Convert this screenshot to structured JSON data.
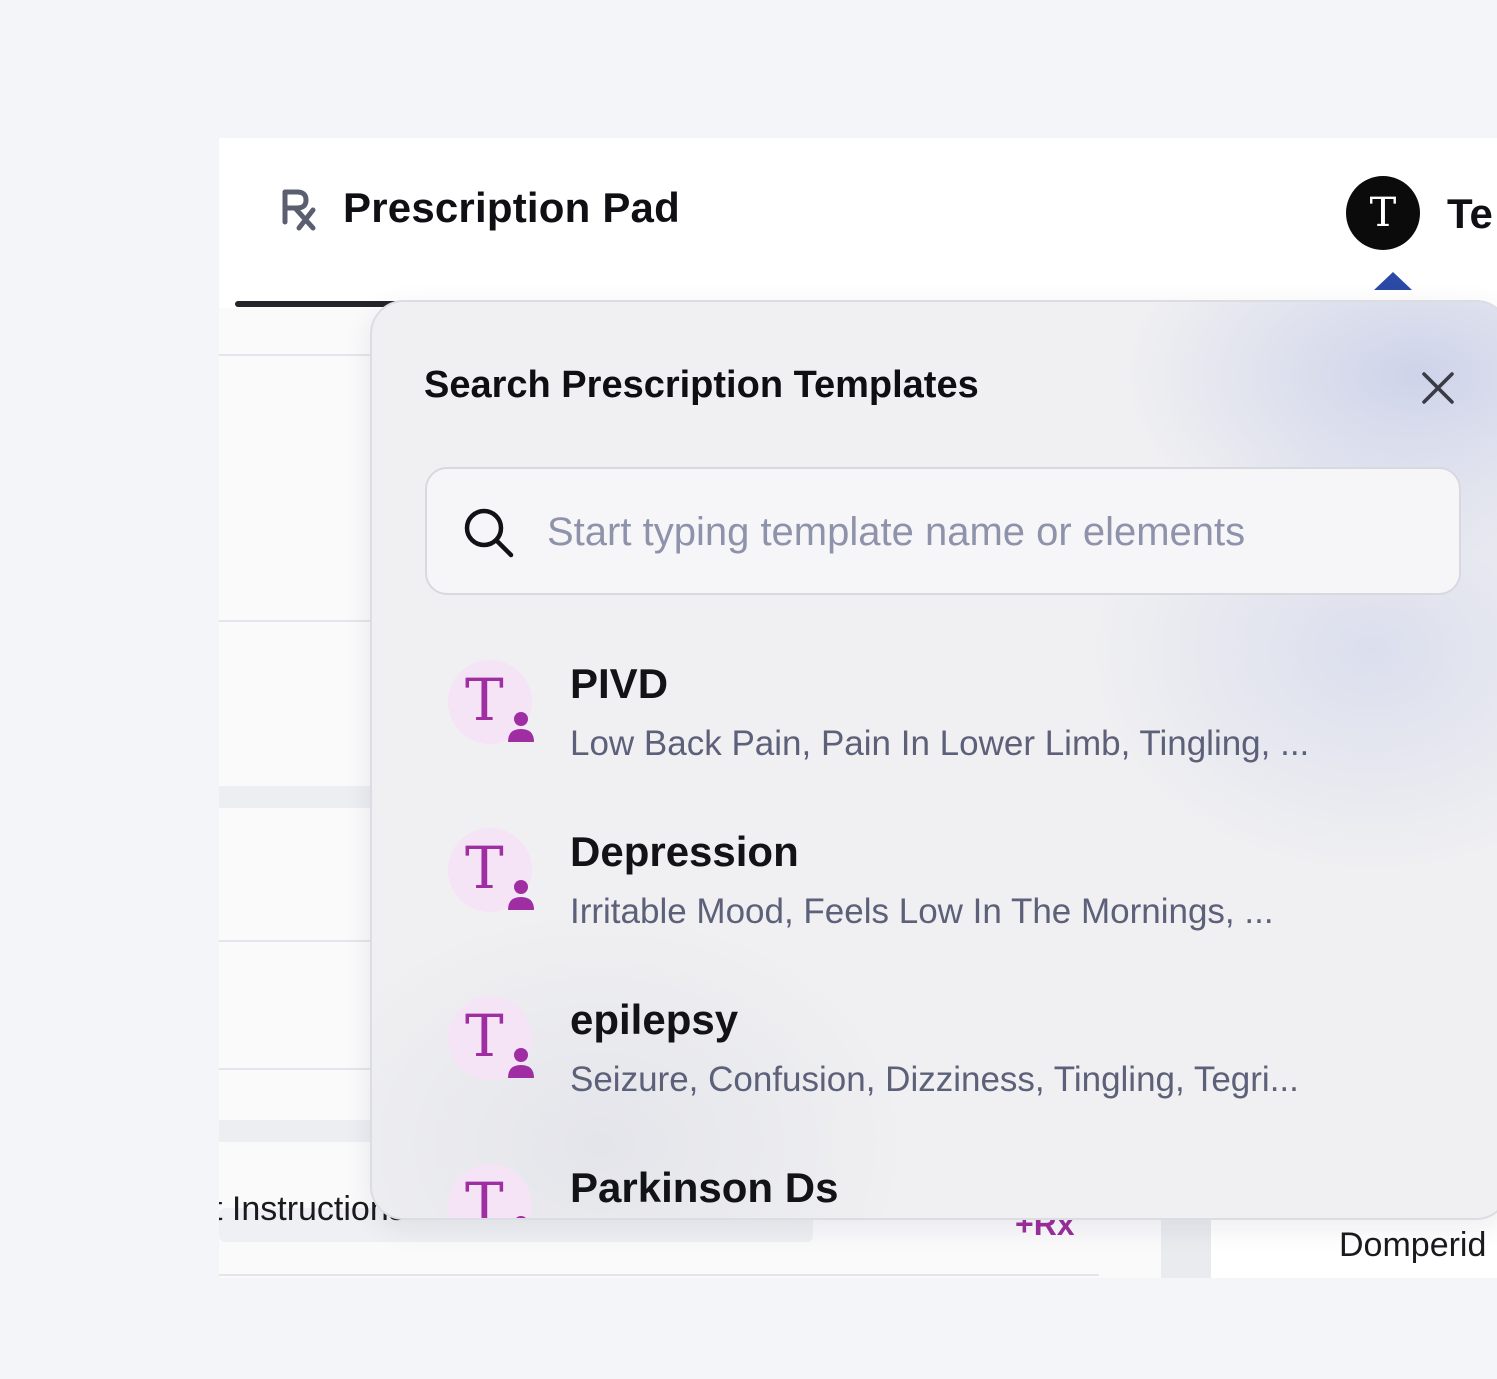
{
  "header": {
    "rx_icon": "prescription-rx-icon",
    "title": "Prescription Pad",
    "avatar_letter": "T",
    "avatar_label": "Te"
  },
  "background": {
    "instructions_text": "t Instructions:",
    "rx_badge": "+Rx",
    "drug_text": "Domperid"
  },
  "template_search": {
    "title": "Search Prescription Templates",
    "close_icon": "close-icon",
    "search_icon": "search-icon",
    "placeholder": "Start typing template name or elements",
    "value": "",
    "results": [
      {
        "name": "PIVD",
        "description": "Low Back Pain, Pain In Lower Limb, Tingling, ..."
      },
      {
        "name": "Depression",
        "description": "Irritable Mood, Feels Low In The Mornings, ..."
      },
      {
        "name": "epilepsy",
        "description": "Seizure, Confusion, Dizziness, Tingling, Tegri..."
      },
      {
        "name": "Parkinson Ds",
        "description": ""
      }
    ],
    "template_icon": "template-user-icon"
  },
  "colors": {
    "accent_purple": "#a02ea3",
    "caret_blue": "#2a4aa6",
    "avatar_bg": "#0b0b0c",
    "placeholder": "#8e93ab"
  }
}
